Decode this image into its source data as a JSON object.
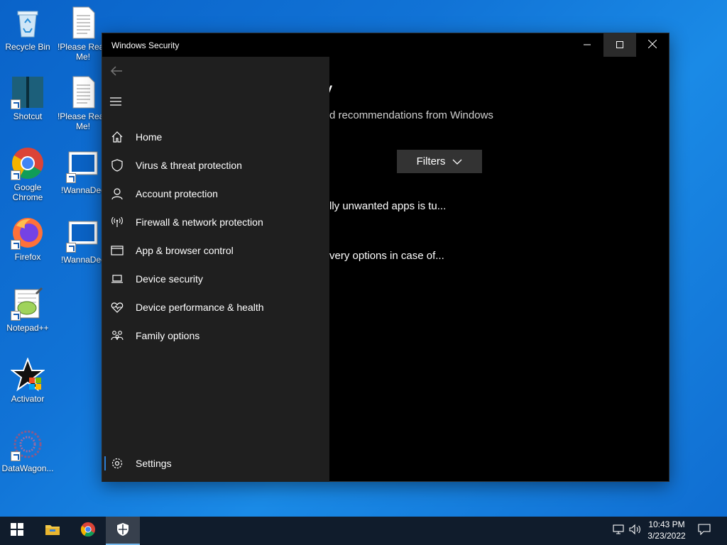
{
  "desktop": {
    "icons": [
      {
        "label": "Recycle Bin",
        "icon": "recycle-bin-icon"
      },
      {
        "label": "!Please Read Me!",
        "icon": "text-document-icon"
      },
      {
        "label": "Shotcut",
        "icon": "shotcut-icon"
      },
      {
        "label": "!Please Read Me!",
        "icon": "text-document-icon"
      },
      {
        "label": "Google Chrome",
        "icon": "chrome-icon"
      },
      {
        "label": "!WannaDec",
        "icon": "wannadecryptor-icon"
      },
      {
        "label": "Firefox",
        "icon": "firefox-icon"
      },
      {
        "label": "!WannaDec",
        "icon": "wannadecryptor-icon"
      },
      {
        "label": "Notepad++",
        "icon": "notepadpp-icon"
      },
      {
        "label": "Activator",
        "icon": "activator-icon"
      },
      {
        "label": "DataWagon...",
        "icon": "datawagon-icon"
      }
    ]
  },
  "window": {
    "title": "Windows Security",
    "controls": {
      "minimize": "minimize-icon",
      "maximize": "maximize-icon",
      "close": "close-icon"
    }
  },
  "main": {
    "title_fragment": "y",
    "subtitle_fragment": "d recommendations from Windows",
    "filters_label": "Filters",
    "recommendations": [
      "lly unwanted apps is tu...",
      "very options in case of..."
    ]
  },
  "nav": {
    "items": [
      {
        "label": "Home",
        "icon": "home-icon"
      },
      {
        "label": "Virus & threat protection",
        "icon": "shield-icon"
      },
      {
        "label": "Account protection",
        "icon": "person-icon"
      },
      {
        "label": "Firewall & network protection",
        "icon": "antenna-icon"
      },
      {
        "label": "App & browser control",
        "icon": "browser-window-icon"
      },
      {
        "label": "Device security",
        "icon": "laptop-icon"
      },
      {
        "label": "Device performance & health",
        "icon": "heart-pulse-icon"
      },
      {
        "label": "Family options",
        "icon": "family-icon"
      }
    ],
    "settings": {
      "label": "Settings",
      "icon": "gear-icon"
    }
  },
  "taskbar": {
    "apps": [
      "start-icon",
      "file-explorer-icon",
      "chrome-icon",
      "windows-security-icon"
    ],
    "clock": {
      "time": "10:43 PM",
      "date": "3/23/2022"
    }
  },
  "colors": {
    "desktop": "#1173d6",
    "nav_background": "#1f1f1f",
    "window_background": "#000000",
    "accent": "#2d7dd2",
    "taskbar": "#101c2c"
  }
}
